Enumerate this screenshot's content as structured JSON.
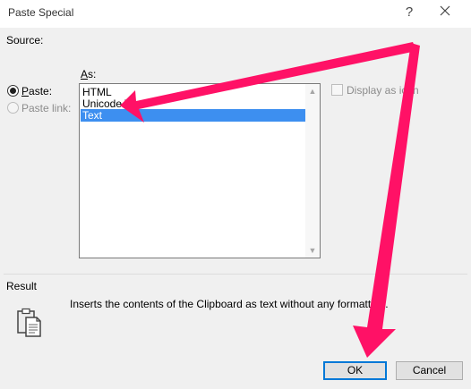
{
  "window": {
    "title": "Paste Special",
    "help_glyph": "?",
    "close_icon": "close-icon"
  },
  "source": {
    "label": "Source:"
  },
  "paste_options": {
    "paste_label_accel": "P",
    "paste_label_rest": "aste:",
    "paste_link_label": "Paste link:",
    "selected": "Paste"
  },
  "as": {
    "label_accel": "A",
    "label_rest": "s:",
    "items": [
      "HTML",
      "Unicode Text",
      "Text"
    ],
    "selected_index": 2
  },
  "display_as_icon": {
    "label": "Display as icon",
    "checked": false,
    "enabled": false
  },
  "result": {
    "label": "Result",
    "description": "Inserts the contents of the Clipboard as text without any formatting.",
    "icon": "clipboard-icon"
  },
  "buttons": {
    "ok": "OK",
    "cancel": "Cancel"
  },
  "annotation": {
    "arrow_color": "#ff1166",
    "arrows": [
      "points-to-text-item",
      "points-to-ok-button"
    ]
  },
  "colors": {
    "selection": "#3d8ff0",
    "focus_border": "#0078d7",
    "dialog_bg": "#f0f0f0"
  }
}
